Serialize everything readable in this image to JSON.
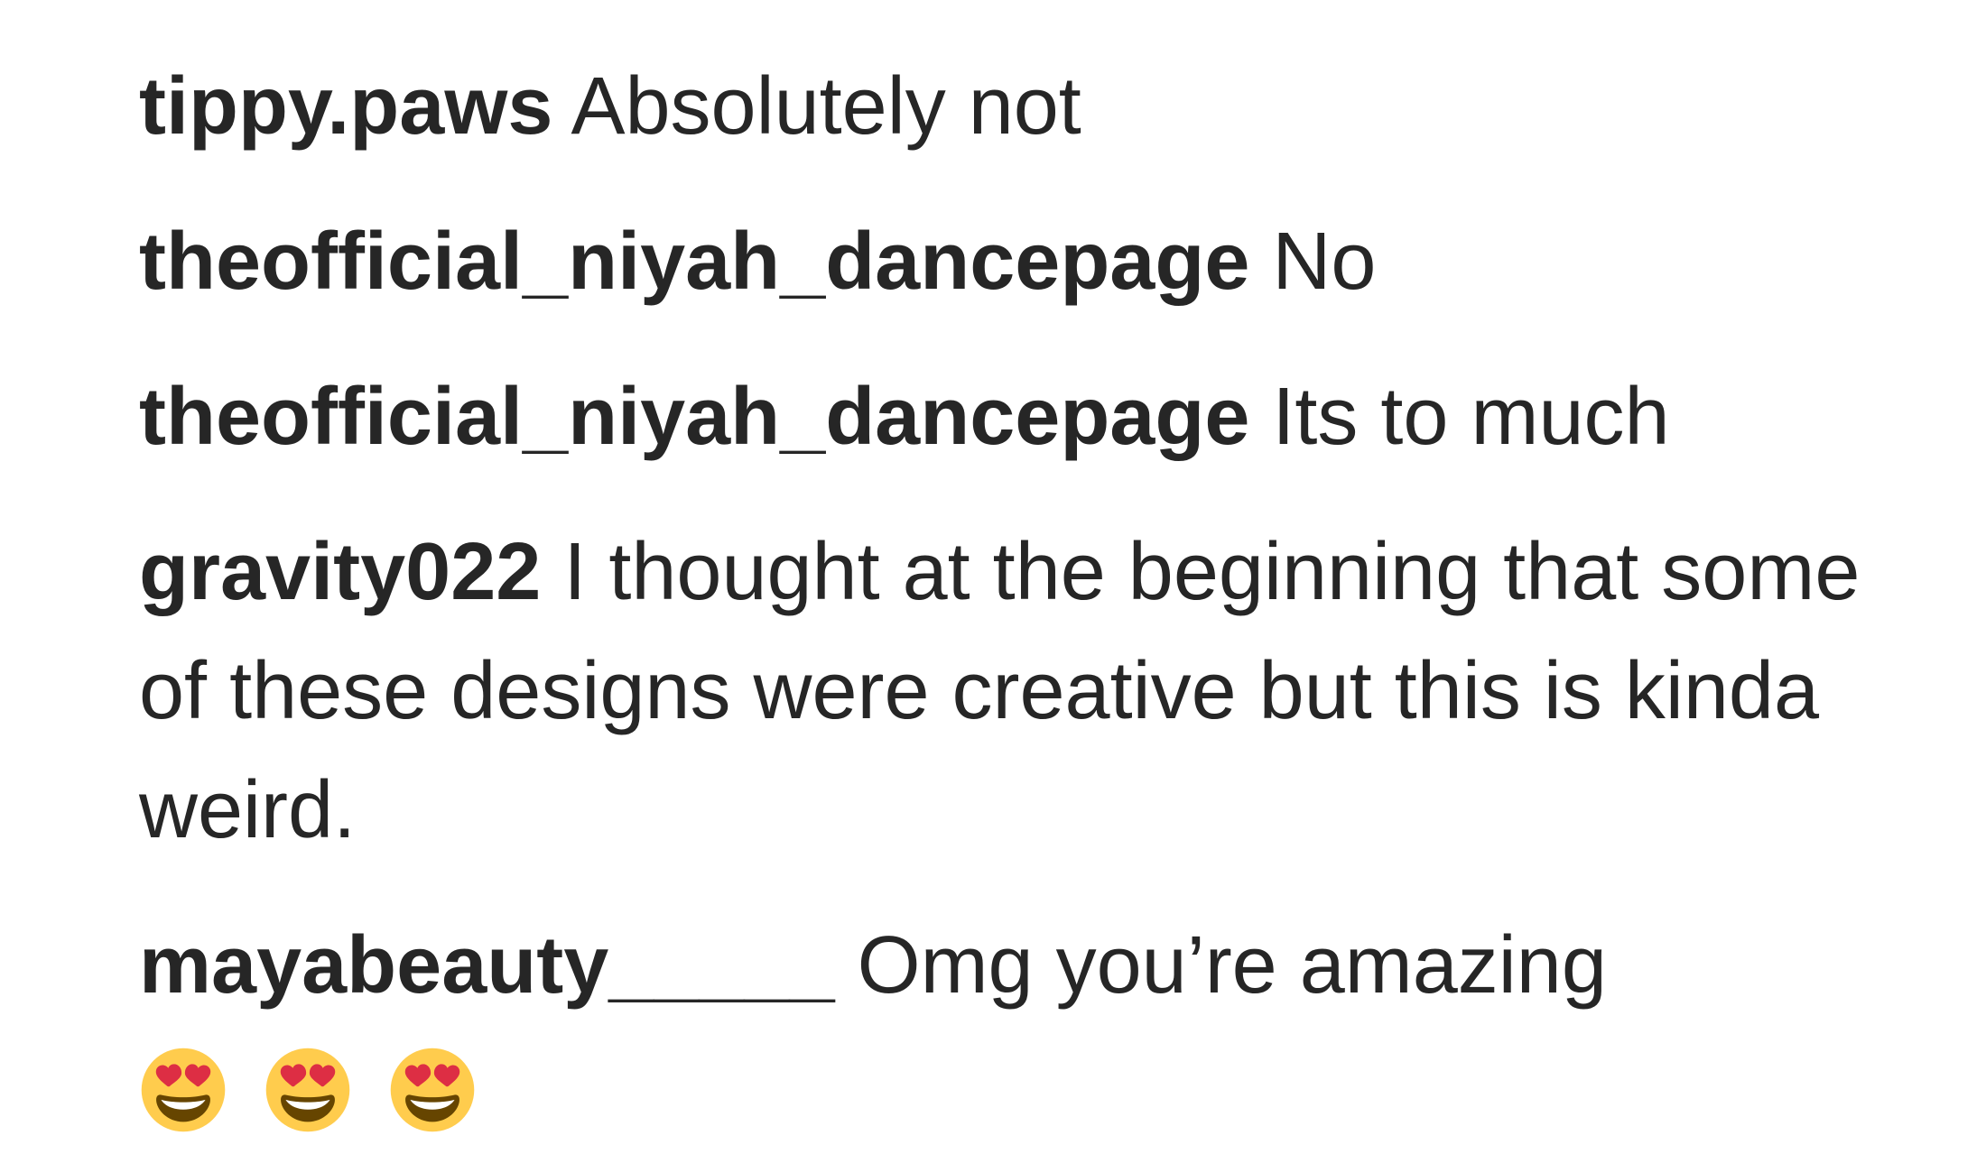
{
  "comments": [
    {
      "username": "tippy.paws",
      "text": "Absolutely not"
    },
    {
      "username": "theofficial_niyah_dancepage",
      "text": "No"
    },
    {
      "username": "theofficial_niyah_dancepage",
      "text": "Its to much"
    },
    {
      "username": "gravity022",
      "text": "I thought at the beginning that some of these designs were creative but this is kinda weird."
    },
    {
      "username": "mayabeauty_____",
      "text": "Omg you’re amazing",
      "emojis": [
        "heart-eyes-emoji",
        "heart-eyes-emoji",
        "heart-eyes-emoji"
      ]
    }
  ],
  "colors": {
    "text": "#262626",
    "emoji_face": "#ffcc4d",
    "emoji_heart": "#dd2e44",
    "emoji_mouth": "#664500"
  }
}
